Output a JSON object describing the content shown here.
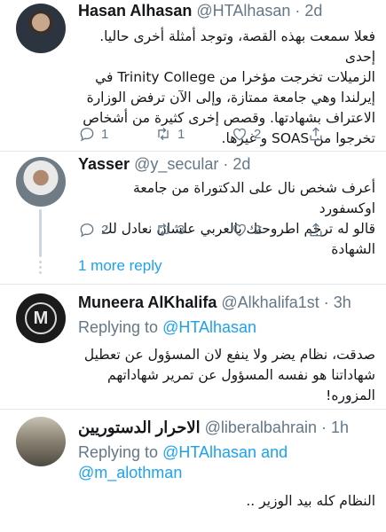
{
  "tweets": [
    {
      "name": "Hasan Alhasan",
      "handle": "@HTAlhasan",
      "time": "· 2d",
      "avatar_icon": "profile-photo",
      "lines": [
        "فعلا سمعت بهذه القصة، وتوجد أمثلة أخرى حاليا. إحدى",
        "الزميلات تخرجت مؤخرا من Trinity College في",
        "إيرلندا وهي جامعة ممتازة، وإلى الآن ترفض الوزارة",
        "الاعتراف بشهادتها. وقصص إخرى كثيرة من أشخاص",
        "تخرجوا من SOAS و غيرها."
      ],
      "counts": {
        "reply": "1",
        "retweet": "1",
        "like": "2"
      }
    },
    {
      "name": "Yasser",
      "handle": "@y_secular",
      "time": "· 2d",
      "avatar_icon": "profile-photo",
      "lines": [
        "أعرف شخص نال على الدكتوراة من جامعة اوكسفورد",
        "قالو له ترجم اطروحتك بالعربي علشان نعادل لك الشهادة"
      ],
      "counts": {
        "reply": "2",
        "retweet": "3",
        "like": "2"
      }
    },
    {
      "name": "Muneera AlKhalifa",
      "handle": "@Alkhalifa1st",
      "time": "· 3h",
      "avatar_letter": "M",
      "replying_prefix": "Replying to",
      "replying_to": "@HTAlhasan",
      "lines": [
        "صدقت، نظام يضر ولا ينفع لان المسؤول عن تعطيل",
        "شهاداتنا هو نفسه المسؤول عن تمرير شهاداتهم المزوره!"
      ]
    },
    {
      "name": "الاحرار الدستوريين",
      "handle": "@liberalbahrain",
      "time": "· 1h",
      "avatar_icon": "group-photo",
      "replying_prefix": "Replying to",
      "replying_to": "@HTAlhasan",
      "replying_and": "and",
      "replying_to2": "@m_alothman",
      "lines": [
        "النظام كله بيد الوزير .."
      ]
    }
  ],
  "more_replies": "1 more reply",
  "colors": {
    "accent": "#1da1f2",
    "muted": "#657786",
    "separator": "#e1e8ed"
  }
}
